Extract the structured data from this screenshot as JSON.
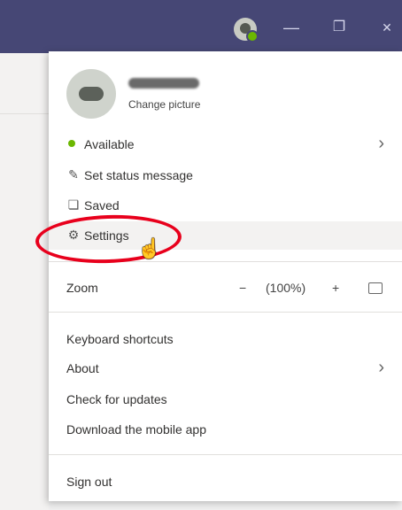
{
  "titlebar": {
    "minimize": "—",
    "restore": "❐",
    "close": "✕"
  },
  "profile": {
    "change_picture": "Change picture"
  },
  "menu": {
    "available": "Available",
    "set_status": "Set status message",
    "saved": "Saved",
    "settings": "Settings",
    "zoom": "Zoom",
    "zoom_minus": "−",
    "zoom_level": "(100%)",
    "zoom_plus": "+",
    "keyboard_shortcuts": "Keyboard shortcuts",
    "about": "About",
    "check_updates": "Check for updates",
    "download_mobile": "Download the mobile app",
    "sign_out": "Sign out"
  },
  "icons": {
    "chevron": "›",
    "edit": "✎",
    "bookmark": "❏",
    "gear": "⚙",
    "hand_cursor": "☝"
  },
  "colors": {
    "titlebar": "#464775",
    "presence_available": "#6bb700",
    "highlight_ellipse": "#e8001c"
  }
}
